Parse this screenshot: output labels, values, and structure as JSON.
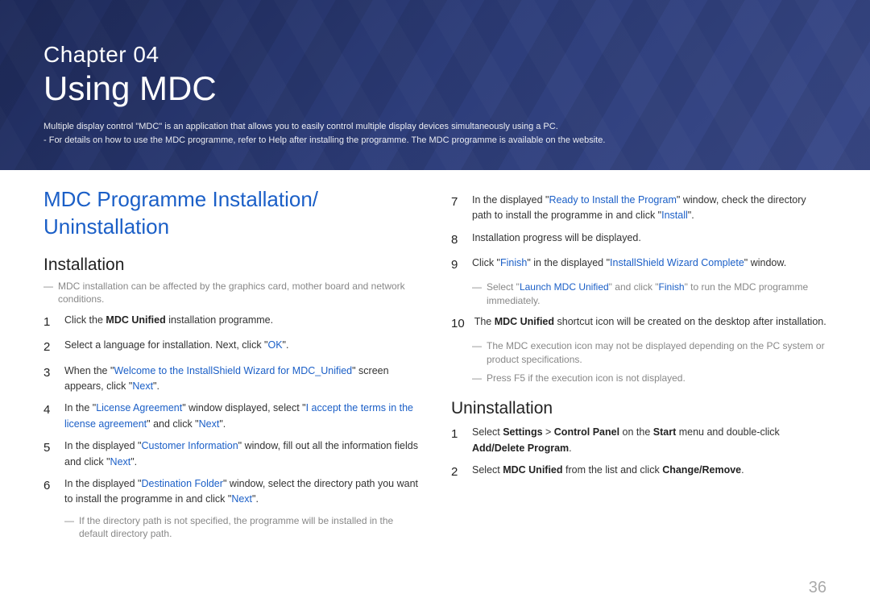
{
  "header": {
    "chapter_label": "Chapter 04",
    "title": "Using MDC",
    "desc1": "Multiple display control \"MDC\" is an application that allows you to easily control multiple display devices simultaneously using a PC.",
    "desc2": "- For details on how to use the MDC programme, refer to Help after installing the programme. The MDC programme is available on the website."
  },
  "left": {
    "section_title_1": "MDC Programme Installation/",
    "section_title_2": "Uninstallation",
    "installation_heading": "Installation",
    "note_affect": "MDC installation can be affected by the graphics card, mother board and network conditions.",
    "s1_a": "Click the ",
    "s1_b": "MDC Unified",
    "s1_c": " installation programme.",
    "s2_a": "Select a language for installation. Next, click \"",
    "s2_b": "OK",
    "s2_c": "\".",
    "s3_a": "When the \"",
    "s3_b": "Welcome to the InstallShield Wizard for MDC_Unified",
    "s3_c": "\" screen appears, click \"",
    "s3_d": "Next",
    "s3_e": "\".",
    "s4_a": "In the \"",
    "s4_b": "License Agreement",
    "s4_c": "\" window displayed, select \"",
    "s4_d": "I accept the terms in the license agreement",
    "s4_e": "\" and click \"",
    "s4_f": "Next",
    "s4_g": "\".",
    "s5_a": "In the displayed \"",
    "s5_b": "Customer Information",
    "s5_c": "\" window, fill out all the information fields and click \"",
    "s5_d": "Next",
    "s5_e": "\".",
    "s6_a": "In the displayed \"",
    "s6_b": "Destination Folder",
    "s6_c": "\" window, select the directory path you want to install the programme in and click \"",
    "s6_d": "Next",
    "s6_e": "\".",
    "note_dir": "If the directory path is not specified, the programme will be installed in the default directory path."
  },
  "right": {
    "s7_a": "In the displayed \"",
    "s7_b": "Ready to Install the Program",
    "s7_c": "\" window, check the directory path to install the programme in and click \"",
    "s7_d": "Install",
    "s7_e": "\".",
    "s8": "Installation progress will be displayed.",
    "s9_a": "Click \"",
    "s9_b": "Finish",
    "s9_c": "\" in the displayed \"",
    "s9_d": "InstallShield Wizard Complete",
    "s9_e": "\" window.",
    "s9_note_a": "Select \"",
    "s9_note_b": "Launch MDC Unified",
    "s9_note_c": "\" and click \"",
    "s9_note_d": "Finish",
    "s9_note_e": "\" to run the MDC programme immediately.",
    "s10_a": "The ",
    "s10_b": "MDC Unified",
    "s10_c": " shortcut icon will be created on the desktop after installation.",
    "s10_note1": "The MDC execution icon may not be displayed depending on the PC system or product specifications.",
    "s10_note2": "Press F5 if the execution icon is not displayed.",
    "uninstall_heading": "Uninstallation",
    "u1_a": "Select ",
    "u1_b": "Settings",
    "u1_c": " > ",
    "u1_d": "Control Panel",
    "u1_e": " on the ",
    "u1_f": "Start",
    "u1_g": " menu and double-click ",
    "u1_h": "Add/Delete Program",
    "u1_i": ".",
    "u2_a": "Select ",
    "u2_b": "MDC Unified",
    "u2_c": " from the list and click ",
    "u2_d": "Change/Remove",
    "u2_e": "."
  },
  "nums": {
    "n1": "1",
    "n2": "2",
    "n3": "3",
    "n4": "4",
    "n5": "5",
    "n6": "6",
    "n7": "7",
    "n8": "8",
    "n9": "9",
    "n10": "10"
  },
  "dash": "―",
  "page_number": "36"
}
